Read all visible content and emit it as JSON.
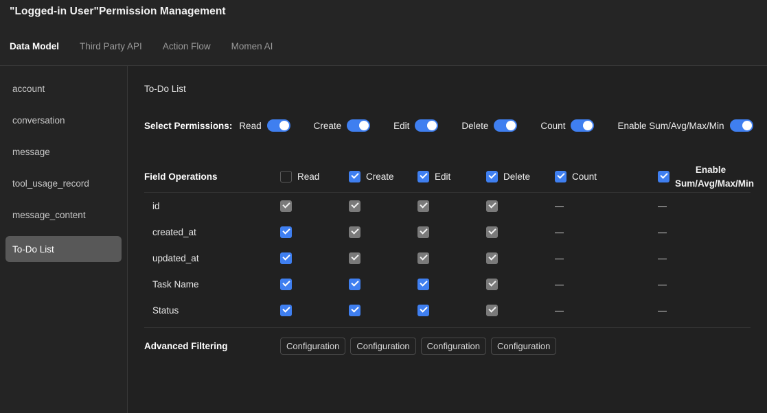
{
  "header": {
    "title": "\"Logged-in User\"Permission Management",
    "tabs": [
      {
        "label": "Data Model",
        "active": true
      },
      {
        "label": "Third Party API",
        "active": false
      },
      {
        "label": "Action Flow",
        "active": false
      },
      {
        "label": "Momen AI",
        "active": false
      }
    ]
  },
  "sidebar": {
    "items": [
      {
        "label": "account",
        "active": false
      },
      {
        "label": "conversation",
        "active": false
      },
      {
        "label": "message",
        "active": false
      },
      {
        "label": "tool_usage_record",
        "active": false
      },
      {
        "label": "message_content",
        "active": false
      },
      {
        "label": "To-Do List",
        "active": true
      }
    ]
  },
  "main": {
    "entity_name": "To-Do List",
    "select_permissions_label": "Select Permissions:",
    "permission_toggles": [
      {
        "label": "Read",
        "on": true
      },
      {
        "label": "Create",
        "on": true
      },
      {
        "label": "Edit",
        "on": true
      },
      {
        "label": "Delete",
        "on": true
      },
      {
        "label": "Count",
        "on": true
      },
      {
        "label": "Enable Sum/Avg/Max/Min",
        "on": true
      }
    ],
    "matrix": {
      "row_header_label": "Field Operations",
      "columns": [
        {
          "label": "Read",
          "state": "off"
        },
        {
          "label": "Create",
          "state": "on"
        },
        {
          "label": "Edit",
          "state": "on"
        },
        {
          "label": "Delete",
          "state": "on"
        },
        {
          "label": "Count",
          "state": "on"
        },
        {
          "label": "Enable Sum/Avg/Max/Min",
          "state": "on"
        }
      ],
      "rows": [
        {
          "field": "id",
          "cells": [
            "on-dim",
            "on-dim",
            "on-dim",
            "on-dim",
            "dash",
            "dash"
          ]
        },
        {
          "field": "created_at",
          "cells": [
            "on",
            "on-dim",
            "on-dim",
            "on-dim",
            "dash",
            "dash"
          ]
        },
        {
          "field": "updated_at",
          "cells": [
            "on",
            "on-dim",
            "on-dim",
            "on-dim",
            "dash",
            "dash"
          ]
        },
        {
          "field": "Task Name",
          "cells": [
            "on",
            "on",
            "on",
            "on-dim",
            "dash",
            "dash"
          ]
        },
        {
          "field": "Status",
          "cells": [
            "on",
            "on",
            "on",
            "on-dim",
            "dash",
            "dash"
          ]
        }
      ],
      "dash_glyph": "—"
    },
    "advanced_filtering": {
      "label": "Advanced Filtering",
      "buttons": [
        "Configuration",
        "Configuration",
        "Configuration",
        "Configuration"
      ]
    }
  },
  "colors": {
    "accent_blue": "#3f7ff0",
    "disabled_gray": "#7a7a7a",
    "sidebar_active": "#585858",
    "background": "#212121",
    "header_background": "#252525"
  }
}
